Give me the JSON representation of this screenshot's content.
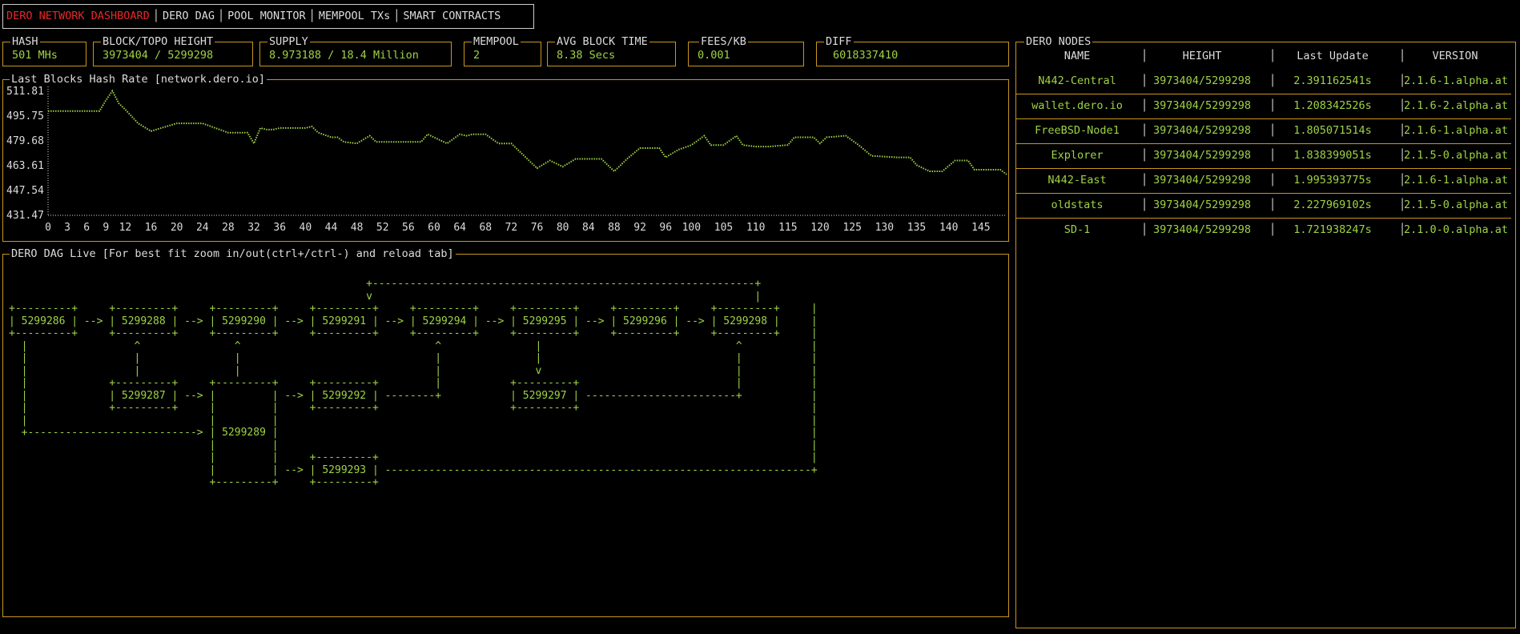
{
  "tabs": [
    {
      "label": "DERO NETWORK DASHBOARD",
      "active": true
    },
    {
      "label": "DERO DAG",
      "active": false
    },
    {
      "label": "POOL MONITOR",
      "active": false
    },
    {
      "label": "MEMPOOL TXs",
      "active": false
    },
    {
      "label": "SMART CONTRACTS",
      "active": false
    }
  ],
  "stats": {
    "hash": {
      "label": "HASH",
      "value": "501 MHs"
    },
    "height": {
      "label": "BLOCK/TOPO HEIGHT",
      "value": "3973404 / 5299298"
    },
    "supply": {
      "label": "SUPPLY",
      "value": "8.973188 / 18.4 Million"
    },
    "mempool": {
      "label": "MEMPOOL",
      "value": "2"
    },
    "avg_block_time": {
      "label": "AVG BLOCK TIME",
      "value": "8.38 Secs"
    },
    "fees": {
      "label": "FEES/KB",
      "value": "0.001"
    },
    "diff": {
      "label": "DIFF",
      "value": "6018337410"
    }
  },
  "chart_panel": {
    "title": "Last Blocks Hash Rate [network.dero.io]"
  },
  "chart_data": {
    "type": "line",
    "title": "Last Blocks Hash Rate [network.dero.io]",
    "yticks": [
      "431.47",
      "447.54",
      "463.61",
      "479.68",
      "495.75",
      "511.81"
    ],
    "ylim": [
      431.47,
      511.81
    ],
    "xticks": [
      "0",
      "3",
      "6",
      "9",
      "12",
      "16",
      "20",
      "24",
      "28",
      "32",
      "36",
      "40",
      "44",
      "48",
      "52",
      "56",
      "60",
      "64",
      "68",
      "72",
      "76",
      "80",
      "84",
      "88",
      "92",
      "96",
      "100",
      "105",
      "110",
      "115",
      "120",
      "125",
      "130",
      "135",
      "140",
      "145"
    ],
    "xlim": [
      0,
      149
    ],
    "color": "#9ed244",
    "points": [
      [
        0,
        499
      ],
      [
        8,
        499
      ],
      [
        9,
        506
      ],
      [
        10,
        512
      ],
      [
        11,
        504
      ],
      [
        12,
        500
      ],
      [
        14,
        491
      ],
      [
        16,
        486
      ],
      [
        20,
        491
      ],
      [
        24,
        491
      ],
      [
        28,
        485
      ],
      [
        31,
        485
      ],
      [
        32,
        478
      ],
      [
        33,
        488
      ],
      [
        34,
        487
      ],
      [
        35,
        487
      ],
      [
        36,
        488
      ],
      [
        40,
        488
      ],
      [
        41,
        489
      ],
      [
        42,
        485
      ],
      [
        44,
        482
      ],
      [
        45,
        482
      ],
      [
        46,
        479
      ],
      [
        48,
        478
      ],
      [
        50,
        483
      ],
      [
        51,
        479
      ],
      [
        54,
        479
      ],
      [
        58,
        479
      ],
      [
        59,
        484
      ],
      [
        62,
        478
      ],
      [
        64,
        484
      ],
      [
        65,
        483
      ],
      [
        66,
        484
      ],
      [
        68,
        484
      ],
      [
        70,
        478
      ],
      [
        72,
        478
      ],
      [
        74,
        470
      ],
      [
        76,
        462
      ],
      [
        78,
        467
      ],
      [
        80,
        463
      ],
      [
        82,
        468
      ],
      [
        86,
        468
      ],
      [
        88,
        460
      ],
      [
        90,
        468
      ],
      [
        92,
        475
      ],
      [
        95,
        475
      ],
      [
        96,
        469
      ],
      [
        98,
        474
      ],
      [
        100,
        477
      ],
      [
        102,
        483
      ],
      [
        103,
        477
      ],
      [
        105,
        477
      ],
      [
        107,
        483
      ],
      [
        108,
        477
      ],
      [
        110,
        476
      ],
      [
        112,
        476
      ],
      [
        115,
        477
      ],
      [
        116,
        482
      ],
      [
        119,
        482
      ],
      [
        120,
        478
      ],
      [
        121,
        482
      ],
      [
        124,
        483
      ],
      [
        126,
        477
      ],
      [
        128,
        470
      ],
      [
        132,
        469
      ],
      [
        134,
        469
      ],
      [
        135,
        464
      ],
      [
        137,
        460
      ],
      [
        139,
        460
      ],
      [
        141,
        467
      ],
      [
        143,
        467
      ],
      [
        144,
        461
      ],
      [
        146,
        461
      ],
      [
        148,
        461
      ],
      [
        149,
        458
      ]
    ]
  },
  "dag_panel": {
    "title": "DERO DAG Live [For best fit zoom in/out(ctrl+/ctrl-) and reload tab]",
    "ascii": "                                                         +-------------------------------------------------------------+\n                                                         v                                                             |\n+---------+     +---------+     +---------+     +---------+     +---------+     +---------+     +---------+     +---------+     |\n| 5299286 | --> | 5299288 | --> | 5299290 | --> | 5299291 | --> | 5299294 | --> | 5299295 | --> | 5299296 | --> | 5299298 |     |\n+---------+     +---------+     +---------+     +---------+     +---------+     +---------+     +---------+     +---------+     |\n  |                 ^               ^                               ^               |                               ^           |\n  |                 |               |                               |               |                               |           |\n  |                 |               |                               |               v                               |           |\n  |             +---------+     +---------+     +---------+         |           +---------+                         |           |\n  |             | 5299287 | --> |         | --> | 5299292 | --------+           | 5299297 | ------------------------+           |\n  |             +---------+     |         |     +---------+                     +---------+                                     |\n  |                             |         |                                                                                     |\n  +---------------------------> | 5299289 |                                                                                     |\n                                |         |                                                                                     |\n                                |         |     +---------+                                                                     |\n                                |         | --> | 5299293 | --------------------------------------------------------------------+\n                                +---------+     +---------+"
  },
  "nodes": {
    "title": "DERO NODES",
    "headers": {
      "name": "NAME",
      "height": "HEIGHT",
      "update": "Last Update",
      "version": "VERSION"
    },
    "rows": [
      {
        "name": "N442-Central",
        "height": "3973404/5299298",
        "update": "2.391162541s",
        "version": "2.1.6-1.alpha.at"
      },
      {
        "name": "wallet.dero.io",
        "height": "3973404/5299298",
        "update": "1.208342526s",
        "version": "2.1.6-2.alpha.at"
      },
      {
        "name": "FreeBSD-Node1",
        "height": "3973404/5299298",
        "update": "1.805071514s",
        "version": "2.1.6-1.alpha.at"
      },
      {
        "name": "Explorer",
        "height": "3973404/5299298",
        "update": "1.838399051s",
        "version": "2.1.5-0.alpha.at"
      },
      {
        "name": "N442-East",
        "height": "3973404/5299298",
        "update": "1.995393775s",
        "version": "2.1.6-1.alpha.at"
      },
      {
        "name": "oldstats",
        "height": "3973404/5299298",
        "update": "2.227969102s",
        "version": "2.1.5-0.alpha.at"
      },
      {
        "name": "SD-1",
        "height": "3973404/5299298",
        "update": "1.721938247s",
        "version": "2.1.0-0.alpha.at"
      }
    ]
  }
}
